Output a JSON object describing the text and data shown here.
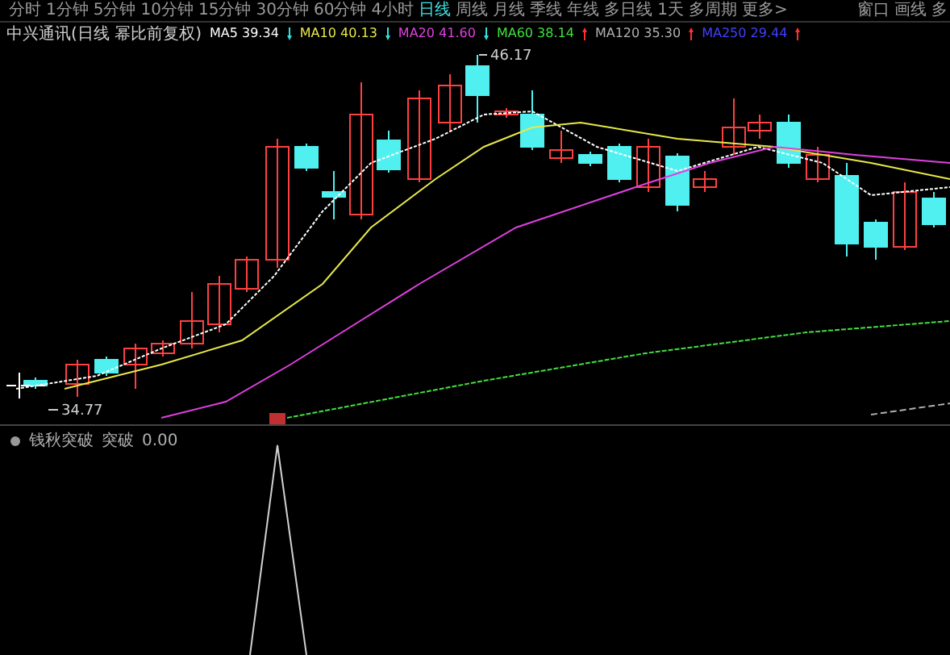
{
  "tabs": [
    {
      "label": "分时",
      "selected": false
    },
    {
      "label": "1分钟",
      "selected": false
    },
    {
      "label": "5分钟",
      "selected": false
    },
    {
      "label": "10分钟",
      "selected": false
    },
    {
      "label": "15分钟",
      "selected": false
    },
    {
      "label": "30分钟",
      "selected": false
    },
    {
      "label": "60分钟",
      "selected": false
    },
    {
      "label": "4小时",
      "selected": false
    },
    {
      "label": "日线",
      "selected": true
    },
    {
      "label": "周线",
      "selected": false
    },
    {
      "label": "月线",
      "selected": false
    },
    {
      "label": "季线",
      "selected": false
    },
    {
      "label": "年线",
      "selected": false
    },
    {
      "label": "多日线",
      "selected": false
    },
    {
      "label": "1天",
      "selected": false
    },
    {
      "label": "多周期",
      "selected": false
    },
    {
      "label": "更多>",
      "selected": false
    }
  ],
  "toolbar_right": [
    "窗口",
    "画线",
    "多"
  ],
  "chart_title": "中兴通讯(日线 幂比前复权)",
  "moving_averages": [
    {
      "label": "MA5",
      "value": "39.34",
      "color": "#ffffff",
      "rising": false
    },
    {
      "label": "MA10",
      "value": "40.13",
      "color": "#e8e84a",
      "rising": false
    },
    {
      "label": "MA20",
      "value": "41.60",
      "color": "#e040e0",
      "rising": false
    },
    {
      "label": "MA60",
      "value": "38.14",
      "color": "#40e040",
      "rising": true
    },
    {
      "label": "MA120",
      "value": "35.30",
      "color": "#b0b0b0",
      "rising": true
    },
    {
      "label": "MA250",
      "value": "29.44",
      "color": "#4040ff",
      "rising": true
    }
  ],
  "price_labels": {
    "high": "46.17",
    "low": "34.77"
  },
  "indicator": {
    "name": "钱秋突破",
    "label": "突破",
    "value": "0.00"
  }
}
